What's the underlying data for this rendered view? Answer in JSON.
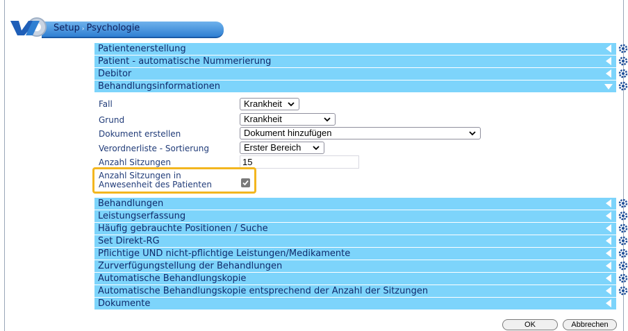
{
  "breadcrumb": {
    "items": [
      "Setup",
      "Psychologie"
    ],
    "separator": "›"
  },
  "colors": {
    "section_bg": "#7dd4fb",
    "highlight": "#f3b61f",
    "label": "#203b78"
  },
  "sections_top": [
    {
      "label": "Patientenerstellung",
      "state": "collapsed"
    },
    {
      "label": "Patient - automatische Nummerierung",
      "state": "collapsed"
    },
    {
      "label": "Debitor",
      "state": "collapsed"
    },
    {
      "label": "Behandlungsinformationen",
      "state": "expanded"
    }
  ],
  "form": {
    "fall": {
      "label": "Fall",
      "value": "Krankheit"
    },
    "grund": {
      "label": "Grund",
      "value": "Krankheit"
    },
    "dokument": {
      "label": "Dokument erstellen",
      "value": "Dokument hinzufügen"
    },
    "verordner": {
      "label": "Verordnerliste - Sortierung",
      "value": "Erster Bereich"
    },
    "sitzungen": {
      "label": "Anzahl Sitzungen",
      "value": "15"
    },
    "anwesenheit": {
      "label_line1": "Anzahl Sitzungen in",
      "label_line2": "Anwesenheit des Patienten",
      "checked": true
    }
  },
  "sections_bottom": [
    {
      "label": "Behandlungen"
    },
    {
      "label": "Leistungserfassung"
    },
    {
      "label": "Häufig gebrauchte Positionen / Suche"
    },
    {
      "label": "Set Direkt-RG"
    },
    {
      "label": "Pflichtige UND nicht-pflichtige Leistungen/Medikamente"
    },
    {
      "label": "Zurverfügungstellung der Behandlungen"
    },
    {
      "label": "Automatische Behandlungskopie"
    },
    {
      "label": "Automatische Behandlungskopie entsprechend der Anzahl der Sitzungen"
    },
    {
      "label": "Dokumente"
    }
  ],
  "buttons": {
    "ok": "OK",
    "cancel": "Abbrechen"
  }
}
